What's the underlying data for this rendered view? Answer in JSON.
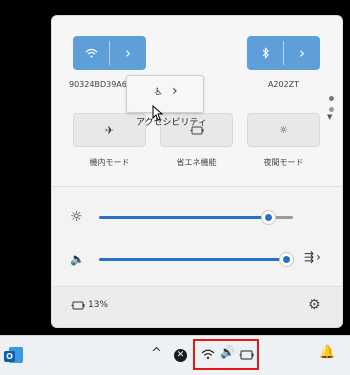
{
  "quick_settings": {
    "wifi": {
      "label": "90324BD39A60-5C",
      "chevron": "›",
      "icon": "wifi-icon"
    },
    "bluetooth": {
      "label": "A202ZT",
      "chevron": "›",
      "icon": "bluetooth-icon"
    },
    "accessibility": {
      "label": "アクセシビリティ",
      "chevron": "›",
      "icon": "accessibility-icon"
    },
    "airplane": {
      "label": "機内モード",
      "icon": "airplane-icon"
    },
    "battery_saver": {
      "label": "省エネ機能",
      "icon": "battery-saver-icon"
    },
    "night_light": {
      "label": "夜間モード",
      "icon": "night-light-icon"
    }
  },
  "brightness": {
    "icon": "brightness-icon",
    "level_percent": 87
  },
  "volume": {
    "icon": "volume-icon",
    "level_percent": 100,
    "chevron": "›"
  },
  "battery": {
    "text": "13%",
    "icon": "battery-icon"
  },
  "taskbar": {
    "chevron_up": "^",
    "colors": {
      "accent": "#5f9fd9",
      "slider": "#2a6ec6",
      "highlight": "#e01818"
    }
  }
}
